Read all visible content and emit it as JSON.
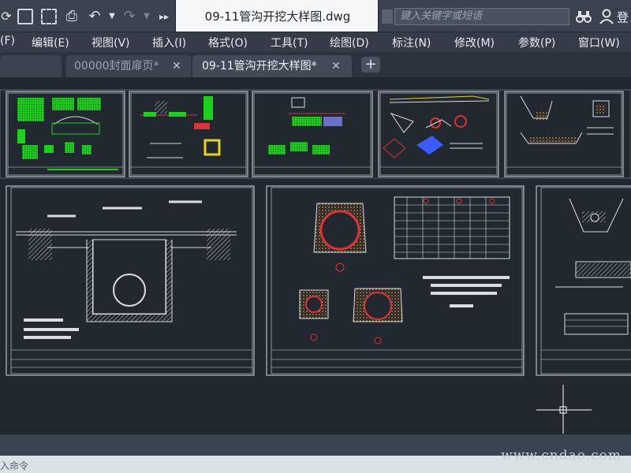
{
  "document_title": "09-11管沟开挖大样图.dwg",
  "search": {
    "placeholder": "键入关键字或短语"
  },
  "user": {
    "login_label": "登"
  },
  "menu": [
    {
      "label": "(F)"
    },
    {
      "label": "编辑(E)"
    },
    {
      "label": "视图(V)"
    },
    {
      "label": "插入(I)"
    },
    {
      "label": "格式(O)"
    },
    {
      "label": "工具(T)"
    },
    {
      "label": "绘图(D)"
    },
    {
      "label": "标注(N)"
    },
    {
      "label": "修改(M)"
    },
    {
      "label": "参数(P)"
    },
    {
      "label": "窗口(W)"
    }
  ],
  "file_tabs": [
    {
      "label": "00000封面扉页*",
      "active": false
    },
    {
      "label": "09-11管沟开挖大样图*",
      "active": true
    }
  ],
  "command_prompt": "入命令",
  "watermark": "www.cndao.com",
  "colors": {
    "drawing_bg": "#212830",
    "frame": "#d8dde2",
    "green": "#19d219",
    "red": "#e03232",
    "yellow": "#e8d21e",
    "blue": "#3a5cff"
  }
}
